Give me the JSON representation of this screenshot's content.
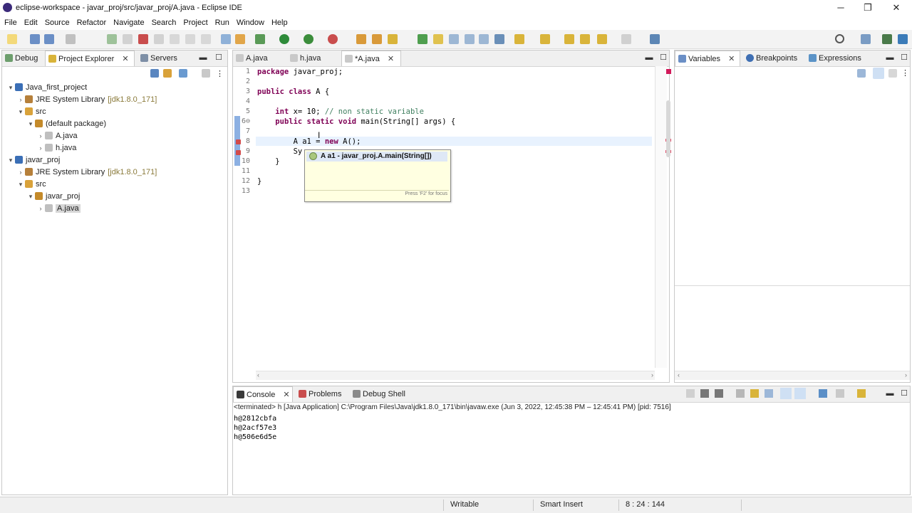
{
  "window": {
    "title": "eclipse-workspace - javar_proj/src/javar_proj/A.java - Eclipse IDE",
    "minimize": "─",
    "restore": "❐",
    "close": "✕"
  },
  "menubar": [
    "File",
    "Edit",
    "Source",
    "Refactor",
    "Navigate",
    "Search",
    "Project",
    "Run",
    "Window",
    "Help"
  ],
  "left_panel": {
    "tabs": [
      {
        "label": "Debug"
      },
      {
        "label": "Project Explorer",
        "close": "✕"
      },
      {
        "label": "Servers"
      }
    ],
    "tree": [
      {
        "label": "Java_first_project",
        "indent": 0,
        "arrow": "▾",
        "icon": "project-icon"
      },
      {
        "label": "JRE System Library",
        "suffix": "[jdk1.8.0_171]",
        "indent": 1,
        "arrow": "›",
        "icon": "library-icon"
      },
      {
        "label": "src",
        "indent": 1,
        "arrow": "▾",
        "icon": "folder-icon"
      },
      {
        "label": "(default package)",
        "indent": 2,
        "arrow": "▾",
        "icon": "package-icon"
      },
      {
        "label": "A.java",
        "indent": 3,
        "arrow": "›",
        "icon": "java-file-icon"
      },
      {
        "label": "h.java",
        "indent": 3,
        "arrow": "›",
        "icon": "java-file-icon"
      },
      {
        "label": "javar_proj",
        "indent": 0,
        "arrow": "▾",
        "icon": "project-icon"
      },
      {
        "label": "JRE System Library",
        "suffix": "[jdk1.8.0_171]",
        "indent": 1,
        "arrow": "›",
        "icon": "library-icon"
      },
      {
        "label": "src",
        "indent": 1,
        "arrow": "▾",
        "icon": "folder-icon"
      },
      {
        "label": "javar_proj",
        "indent": 2,
        "arrow": "▾",
        "icon": "package-icon"
      },
      {
        "label": "A.java",
        "indent": 3,
        "arrow": "›",
        "icon": "java-file-icon",
        "selected": true
      }
    ]
  },
  "editor": {
    "tabs": [
      {
        "label": "A.java"
      },
      {
        "label": "h.java"
      },
      {
        "label": "*A.java",
        "close": "✕",
        "active": true
      }
    ],
    "lines": [
      {
        "n": "1",
        "html": "<span class='kw'>package</span> javar_proj;"
      },
      {
        "n": "2",
        "html": ""
      },
      {
        "n": "3",
        "html": "<span class='kw'>public class</span> A {"
      },
      {
        "n": "4",
        "html": ""
      },
      {
        "n": "5",
        "html": "    <span class='kw'>int</span> x= 10; <span class='cm'>// non static variable</span>"
      },
      {
        "n": "6⊖",
        "html": "    <span class='kw'>public static void</span> main(String[] args) {"
      },
      {
        "n": "7",
        "html": ""
      },
      {
        "n": "8",
        "html": "        A a1 = <span class='kw'>new</span> A();"
      },
      {
        "n": "9",
        "html": "        Sy"
      },
      {
        "n": "10",
        "html": "    }"
      },
      {
        "n": "11",
        "html": ""
      },
      {
        "n": "12",
        "html": "}"
      },
      {
        "n": "13",
        "html": ""
      }
    ],
    "popup": {
      "item": "A a1 - javar_proj.A.main(String[])",
      "footer": "Press 'F2' for focus"
    }
  },
  "right_panel": {
    "tabs": [
      {
        "label": "Variables",
        "close": "✕"
      },
      {
        "label": "Breakpoints"
      },
      {
        "label": "Expressions"
      }
    ]
  },
  "console": {
    "tabs": [
      {
        "label": "Console",
        "close": "✕"
      },
      {
        "label": "Problems"
      },
      {
        "label": "Debug Shell"
      }
    ],
    "header": "<terminated> h [Java Application] C:\\Program Files\\Java\\jdk1.8.0_171\\bin\\javaw.exe (Jun 3, 2022, 12:45:38 PM – 12:45:41 PM) [pid: 7516]",
    "lines": [
      "h@2812cbfa",
      "h@2acf57e3",
      "h@506e6d5e"
    ]
  },
  "status": {
    "writable": "Writable",
    "insert_mode": "Smart Insert",
    "position": "8 : 24 : 144"
  }
}
